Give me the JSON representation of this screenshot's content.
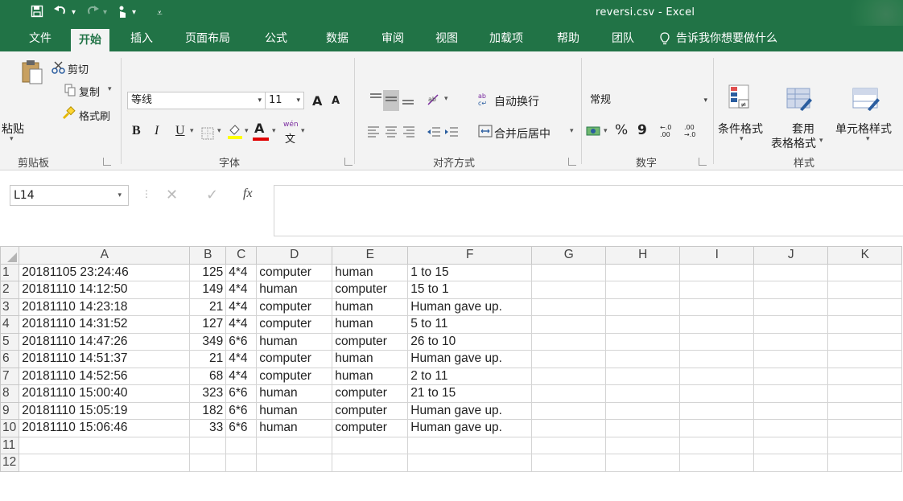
{
  "title_bar": {
    "file_name": "reversi.csv",
    "separator": "-",
    "app_name": "Excel"
  },
  "menu": {
    "tabs": [
      "文件",
      "开始",
      "插入",
      "页面布局",
      "公式",
      "数据",
      "审阅",
      "视图",
      "加载项",
      "帮助",
      "团队"
    ],
    "active_tab": "开始",
    "tell_me": "告诉我你想要做什么"
  },
  "ribbon": {
    "clipboard": {
      "paste": "粘贴",
      "cut": "剪切",
      "copy": "复制",
      "format_painter": "格式刷",
      "group": "剪贴板"
    },
    "font": {
      "font_name": "等线",
      "font_size": "11",
      "grow": "A",
      "shrink": "A",
      "bold": "B",
      "italic": "I",
      "underline": "U",
      "font_color_letter": "A",
      "phonetic_top": "wén",
      "phonetic_bottom": "文",
      "group": "字体"
    },
    "alignment": {
      "wrap_text": "自动换行",
      "merge_center": "合并后居中",
      "group": "对齐方式"
    },
    "number": {
      "format": "常规",
      "percent": "%",
      "comma": "9",
      "inc_decimal": "←.0 .00",
      "dec_decimal": ".00 →.0",
      "group": "数字"
    },
    "styles": {
      "conditional": "条件格式",
      "table_format_1": "套用",
      "table_format_2": "表格格式",
      "cell_styles": "单元格样式",
      "group": "样式"
    }
  },
  "formula_bar": {
    "name_box": "L14",
    "fx": "fx",
    "content": ""
  },
  "sheet": {
    "columns": [
      "A",
      "B",
      "C",
      "D",
      "E",
      "F",
      "G",
      "H",
      "I",
      "J",
      "K"
    ],
    "rows": [
      {
        "n": "1",
        "A": "20181105 23:24:46",
        "B": "125",
        "C": "4*4",
        "D": "computer",
        "E": "human",
        "F": "1 to 15"
      },
      {
        "n": "2",
        "A": "20181110 14:12:50",
        "B": "149",
        "C": "4*4",
        "D": "human",
        "E": "computer",
        "F": "15 to 1"
      },
      {
        "n": "3",
        "A": "20181110 14:23:18",
        "B": "21",
        "C": "4*4",
        "D": "computer",
        "E": "human",
        "F": "Human gave up."
      },
      {
        "n": "4",
        "A": "20181110 14:31:52",
        "B": "127",
        "C": "4*4",
        "D": "computer",
        "E": "human",
        "F": "5 to 11"
      },
      {
        "n": "5",
        "A": "20181110 14:47:26",
        "B": "349",
        "C": "6*6",
        "D": "human",
        "E": "computer",
        "F": "26 to 10"
      },
      {
        "n": "6",
        "A": "20181110 14:51:37",
        "B": "21",
        "C": "4*4",
        "D": "computer",
        "E": "human",
        "F": "Human gave up."
      },
      {
        "n": "7",
        "A": "20181110 14:52:56",
        "B": "68",
        "C": "4*4",
        "D": "computer",
        "E": "human",
        "F": "2 to 11"
      },
      {
        "n": "8",
        "A": "20181110 15:00:40",
        "B": "323",
        "C": "6*6",
        "D": "human",
        "E": "computer",
        "F": "21 to 15"
      },
      {
        "n": "9",
        "A": "20181110 15:05:19",
        "B": "182",
        "C": "6*6",
        "D": "human",
        "E": "computer",
        "F": "Human gave up."
      },
      {
        "n": "10",
        "A": "20181110 15:06:46",
        "B": "33",
        "C": "6*6",
        "D": "human",
        "E": "computer",
        "F": "Human gave up."
      },
      {
        "n": "11",
        "A": "",
        "B": "",
        "C": "",
        "D": "",
        "E": "",
        "F": ""
      },
      {
        "n": "12",
        "A": "",
        "B": "",
        "C": "",
        "D": "",
        "E": "",
        "F": ""
      }
    ]
  },
  "colors": {
    "brand": "#217346",
    "ribbon_bg": "#f3f3f3",
    "gridline": "#d4d4d4"
  }
}
